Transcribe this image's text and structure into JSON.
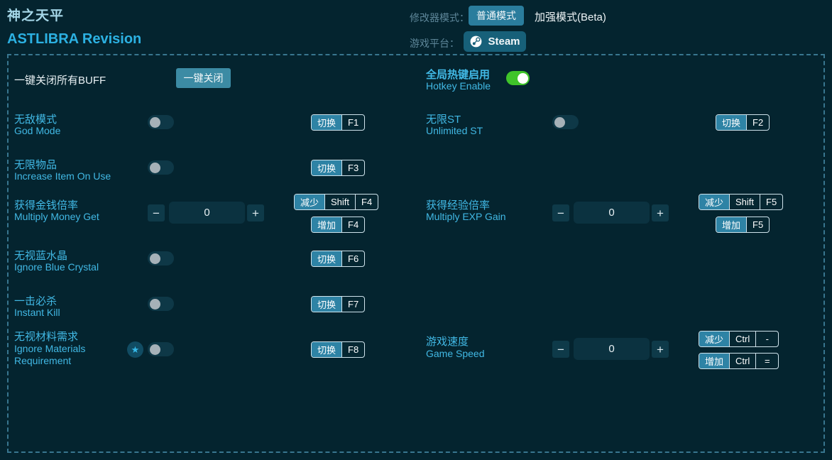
{
  "header": {
    "title_cn": "神之天平",
    "title_en": "ASTLIBRA Revision",
    "mode_label": "修改器模式：",
    "mode_options": [
      "普通模式",
      "加强模式(Beta)"
    ],
    "platform_label": "游戏平台：",
    "platform": "Steam"
  },
  "panel": {
    "buff_label": "一键关闭所有BUFF",
    "buff_button": "一键关闭",
    "hotkey_enable": {
      "cn": "全局热键启用",
      "en": "Hotkey Enable",
      "state": "on"
    },
    "cheats": [
      {
        "cn": "无敌模式",
        "en": "God Mode",
        "type": "toggle",
        "state": "off",
        "keys": {
          "action": "切换",
          "key": "F1"
        }
      },
      {
        "cn": "无限ST",
        "en": "Unlimited ST",
        "type": "toggle",
        "state": "off",
        "keys": {
          "action": "切换",
          "key": "F2"
        }
      },
      {
        "cn": "无限物品",
        "en": "Increase Item On Use",
        "type": "toggle",
        "state": "off",
        "keys": {
          "action": "切换",
          "key": "F3"
        }
      },
      {
        "cn": "获得金钱倍率",
        "en": "Multiply Money Get",
        "type": "stepper",
        "value": "0",
        "keys": {
          "dec_action": "减少",
          "dec_mod": "Shift",
          "dec_key": "F4",
          "inc_action": "增加",
          "inc_key": "F4"
        }
      },
      {
        "cn": "获得经验倍率",
        "en": "Multiply EXP Gain",
        "type": "stepper",
        "value": "0",
        "keys": {
          "dec_action": "减少",
          "dec_mod": "Shift",
          "dec_key": "F5",
          "inc_action": "增加",
          "inc_key": "F5"
        }
      },
      {
        "cn": "无视蓝水晶",
        "en": "Ignore Blue Crystal",
        "type": "toggle",
        "state": "off",
        "keys": {
          "action": "切换",
          "key": "F6"
        }
      },
      {
        "cn": "一击必杀",
        "en": "Instant Kill",
        "type": "toggle",
        "state": "off",
        "keys": {
          "action": "切换",
          "key": "F7"
        }
      },
      {
        "cn": "无视材料需求",
        "en": "Ignore Materials Requirement",
        "type": "toggle",
        "state": "off",
        "starred": true,
        "keys": {
          "action": "切换",
          "key": "F8"
        }
      },
      {
        "cn": "游戏速度",
        "en": "Game Speed",
        "type": "stepper",
        "value": "0",
        "keys": {
          "dec_action": "减少",
          "dec_mod": "Ctrl",
          "dec_key": "-",
          "inc_action": "增加",
          "inc_mod": "Ctrl",
          "inc_key": "="
        }
      }
    ]
  },
  "icons": {
    "star": "★",
    "minus": "−",
    "plus": "+"
  },
  "colors": {
    "background": "#04242f",
    "accent_blue": "#41b8e4",
    "title_blue": "#2cb1e2",
    "button_teal": "#3c8ba4",
    "mode_button": "#2a7d9d",
    "steam_button": "#176079",
    "hotkey_active": "#2e83a5",
    "toggle_on_green": "#3fc42a",
    "panel_border": "#38768f"
  }
}
